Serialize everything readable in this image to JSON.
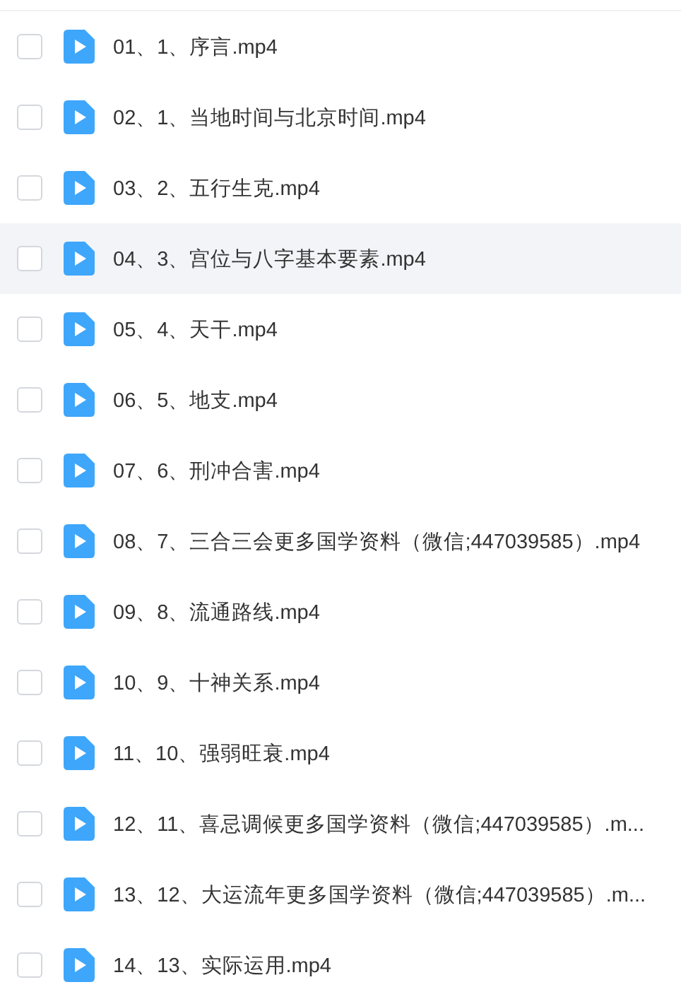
{
  "files": [
    {
      "name": "01、1、序言.mp4",
      "checked": false,
      "hovered": false
    },
    {
      "name": "02、1、当地时间与北京时间.mp4",
      "checked": false,
      "hovered": false
    },
    {
      "name": "03、2、五行生克.mp4",
      "checked": false,
      "hovered": false
    },
    {
      "name": "04、3、宫位与八字基本要素.mp4",
      "checked": false,
      "hovered": true
    },
    {
      "name": "05、4、天干.mp4",
      "checked": false,
      "hovered": false
    },
    {
      "name": "06、5、地支.mp4",
      "checked": false,
      "hovered": false
    },
    {
      "name": "07、6、刑冲合害.mp4",
      "checked": false,
      "hovered": false
    },
    {
      "name": "08、7、三合三会更多国学资料（微信;447039585）.mp4",
      "checked": false,
      "hovered": false
    },
    {
      "name": "09、8、流通路线.mp4",
      "checked": false,
      "hovered": false
    },
    {
      "name": "10、9、十神关系.mp4",
      "checked": false,
      "hovered": false
    },
    {
      "name": "11、10、强弱旺衰.mp4",
      "checked": false,
      "hovered": false
    },
    {
      "name": "12、11、喜忌调候更多国学资料（微信;447039585）.m...",
      "checked": false,
      "hovered": false
    },
    {
      "name": "13、12、大运流年更多国学资料（微信;447039585）.m...",
      "checked": false,
      "hovered": false
    },
    {
      "name": "14、13、实际运用.mp4",
      "checked": false,
      "hovered": false
    }
  ]
}
